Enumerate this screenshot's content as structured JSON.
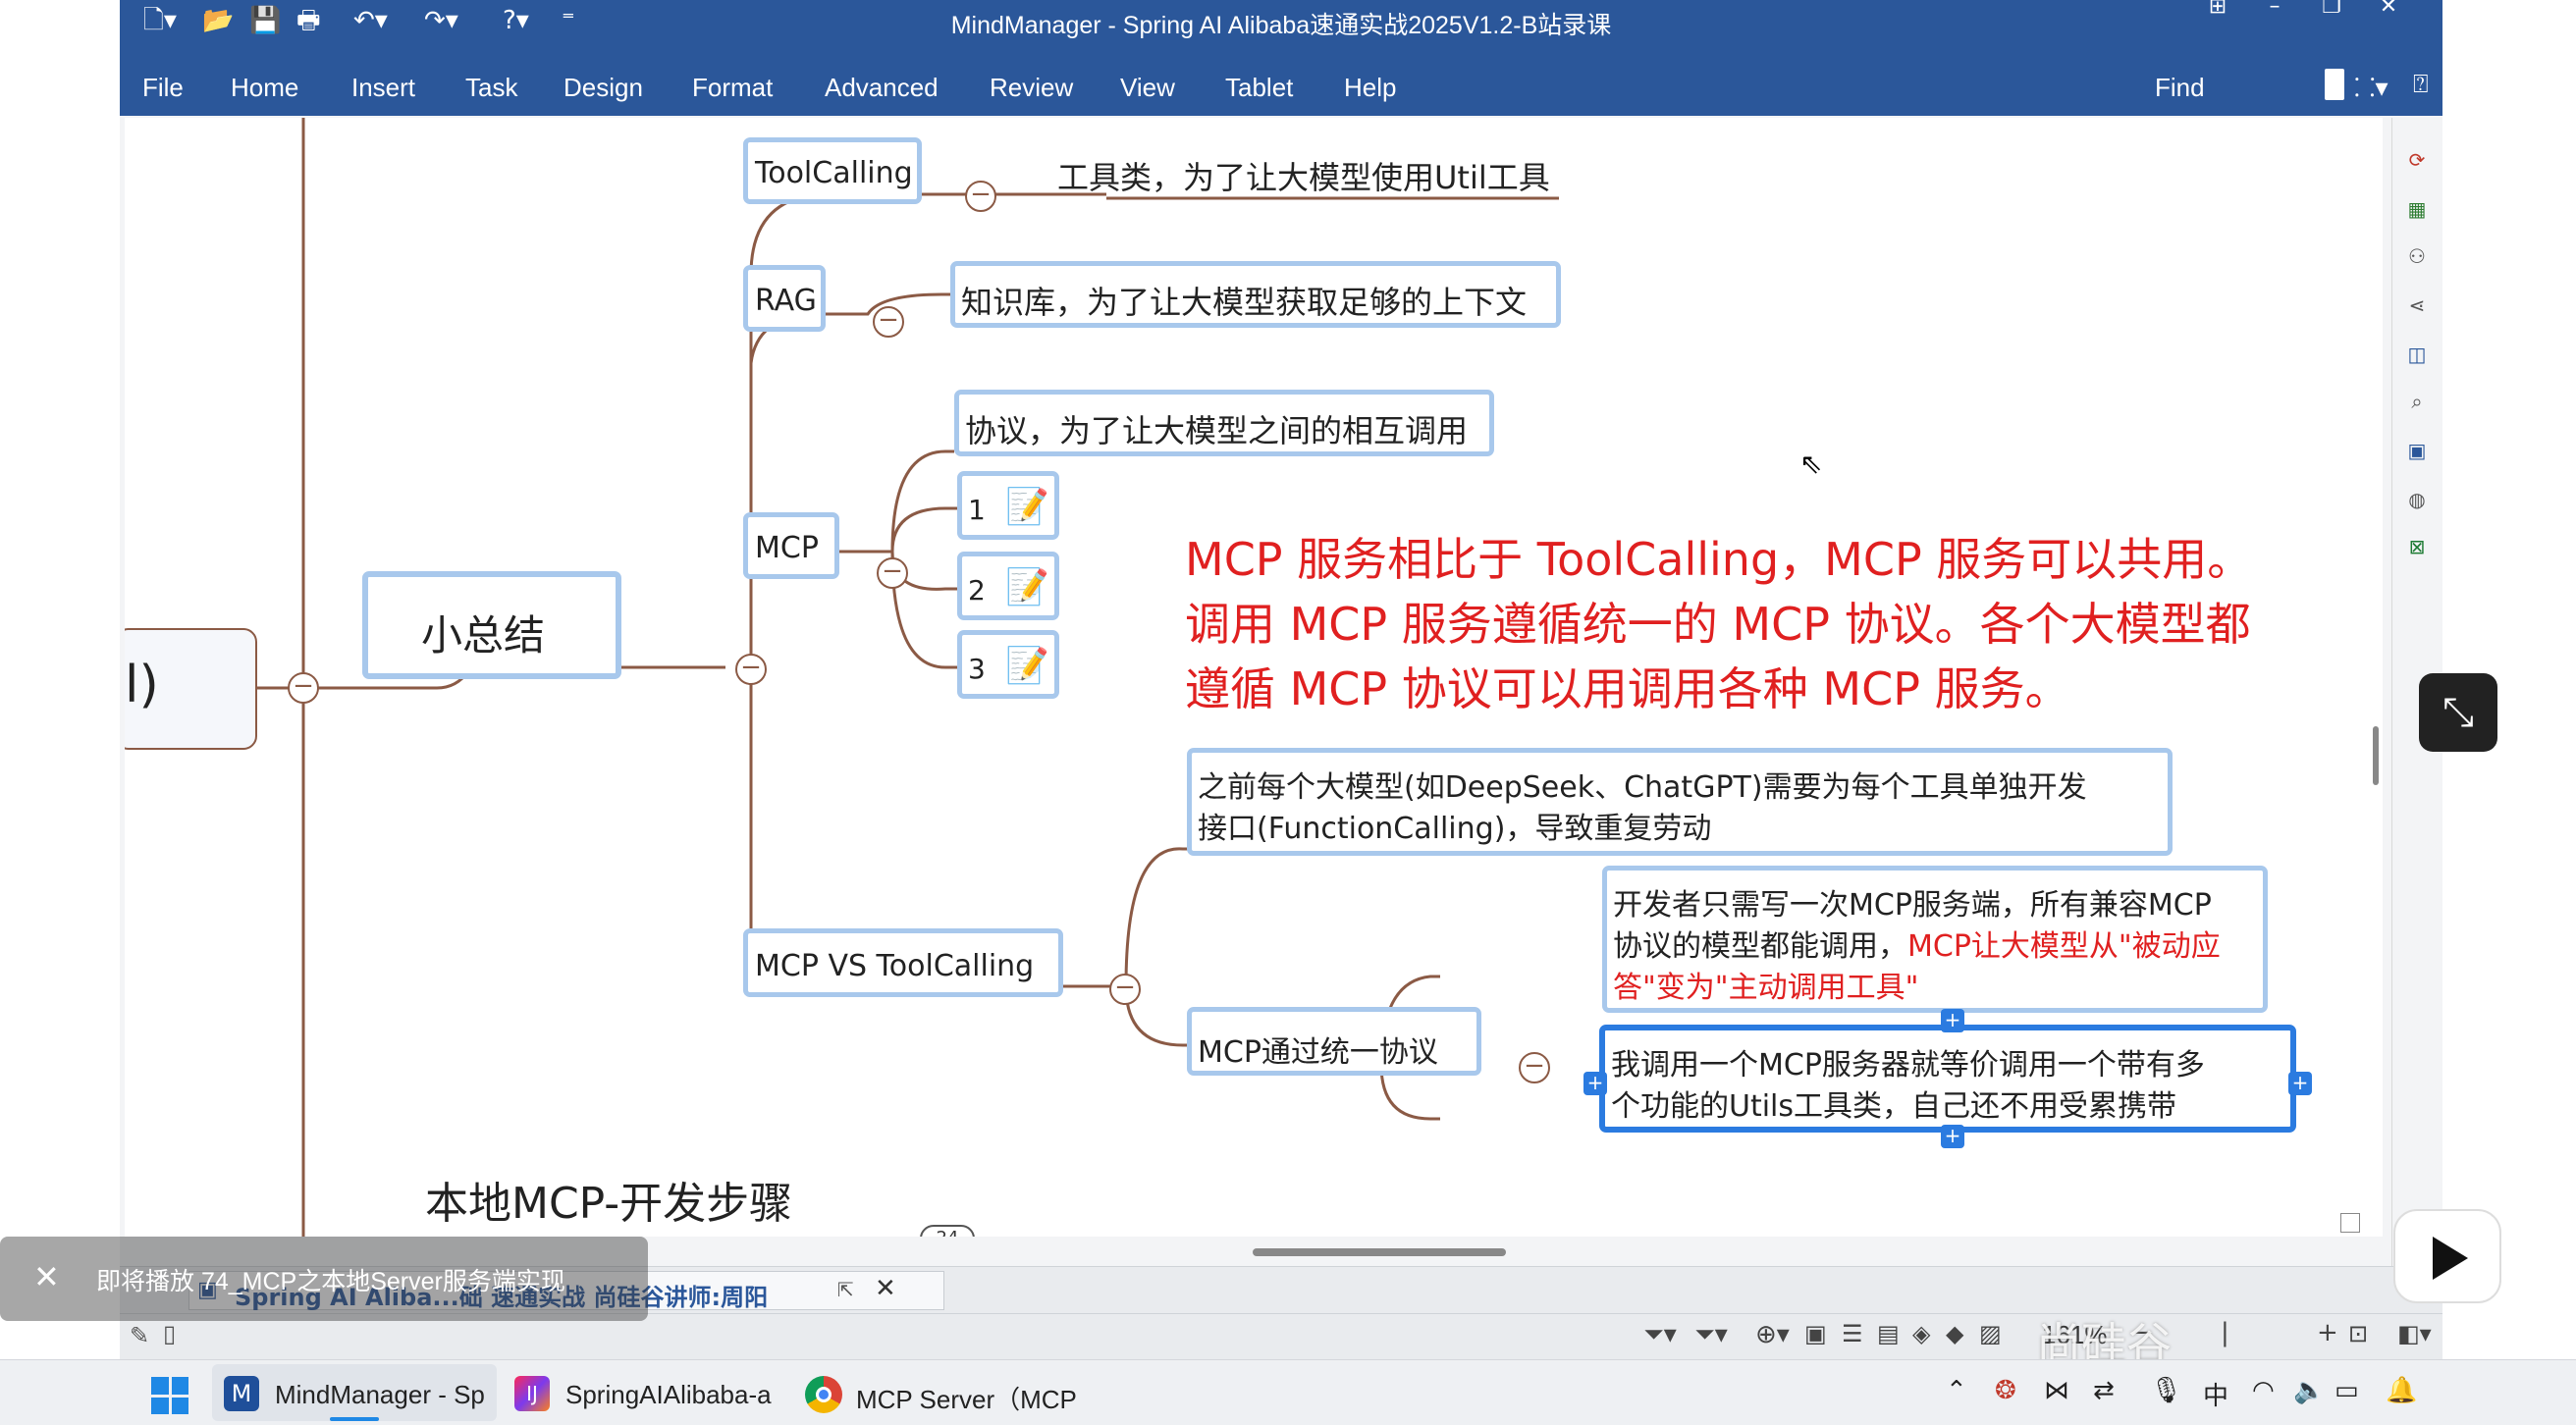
{
  "window": {
    "title": "MindManager - Spring AI Alibaba速通实战2025V1.2-B站录课"
  },
  "menu": [
    "File",
    "Home",
    "Insert",
    "Task",
    "Design",
    "Format",
    "Advanced",
    "Review",
    "View",
    "Tablet",
    "Help"
  ],
  "find_label": "Find",
  "map": {
    "root_fragment": "l)",
    "summary": "小总结",
    "toolcalling": {
      "label": "ToolCalling",
      "desc": "工具类，为了让大模型使用Util工具"
    },
    "rag": {
      "label": "RAG",
      "desc": "知识库，为了让大模型获取足够的上下文"
    },
    "mcp": {
      "label": "MCP",
      "desc": "协议，为了让大模型之间的相互调用",
      "subs": [
        "1",
        "2",
        "3"
      ]
    },
    "red_note": [
      "MCP 服务相比于 ToolCalling，MCP 服务可以共用。",
      "调用 MCP 服务遵循统一的 MCP 协议。各个大模型都",
      "遵循 MCP 协议可以用调用各种 MCP 服务。"
    ],
    "vs": {
      "label": "MCP  VS  ToolCalling",
      "before_line1": "之前每个大模型(如DeepSeek、ChatGPT)需要为每个工具单独开发",
      "before_line2": "接口(FunctionCalling)，导致重复劳动",
      "unified": "MCP通过统一协议",
      "dev_line1": "开发者只需写一次MCP服务端，所有兼容MCP",
      "dev_line2_black": "协议的模型都能调用，",
      "dev_line2_red": "MCP让大模型从\"被动应",
      "dev_line3_red": "答\"变为\"主动调用工具\"",
      "me_line1": "我调用一个MCP服务器就等价调用一个带有多",
      "me_line2": "个功能的Utils工具类，自己还不用受累携带"
    },
    "next_topic": "本地MCP-开发步骤",
    "next_badge": "24"
  },
  "doc_tab": {
    "label": "Spring AI Aliba...础 速通实战 尚硅谷讲师:周阳"
  },
  "notice": {
    "text": "即将播放 74_MCP之本地Server服务端实现"
  },
  "status": {
    "zoom": "161%"
  },
  "taskbar": {
    "apps": [
      "MindManager - Sp",
      "SpringAIAlibaba-a",
      "MCP Server（MCP"
    ],
    "ime": "中"
  },
  "watermark": "尚硅谷",
  "colors": {
    "titlebar": "#2b579a",
    "node_border": "#a8c8ec",
    "branch": "#8b5a45",
    "note_red": "#e02020"
  }
}
